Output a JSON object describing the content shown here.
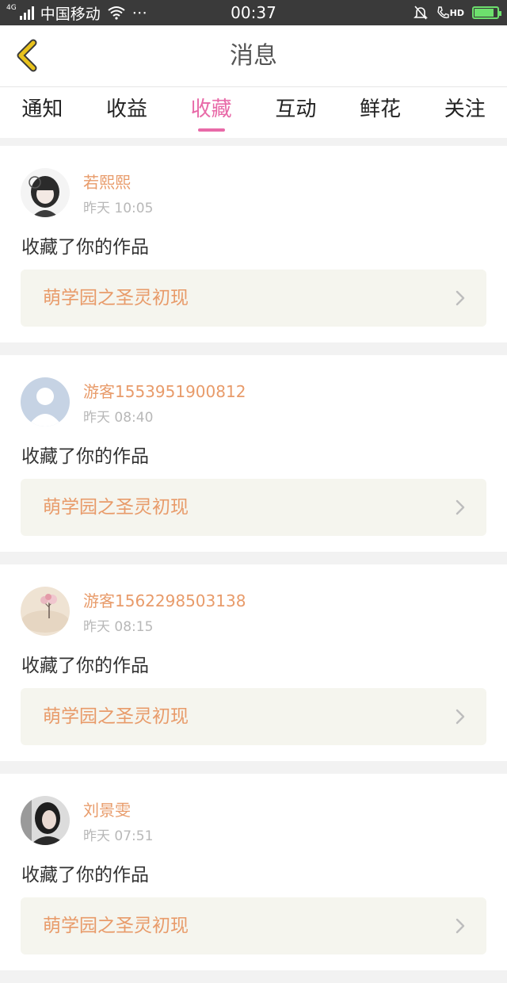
{
  "status": {
    "network": "4G",
    "carrier": "中国移动",
    "time": "00:37",
    "hd": "HD",
    "battery_level": 0.85,
    "accent": "#6de06d"
  },
  "header": {
    "title": "消息",
    "back_icon": "chevron-left-icon",
    "back_color": "#e8c21c"
  },
  "tabs": [
    {
      "label": "通知",
      "active": false
    },
    {
      "label": "收益",
      "active": false
    },
    {
      "label": "收藏",
      "active": true
    },
    {
      "label": "互动",
      "active": false
    },
    {
      "label": "鲜花",
      "active": false
    },
    {
      "label": "关注",
      "active": false
    }
  ],
  "items": [
    {
      "name": "若熙熙",
      "time": "昨天 10:05",
      "action": "收藏了你的作品",
      "work": "萌学园之圣灵初现"
    },
    {
      "name": "游客1553951900812",
      "time": "昨天 08:40",
      "action": "收藏了你的作品",
      "work": "萌学园之圣灵初现"
    },
    {
      "name": "游客1562298503138",
      "time": "昨天 08:15",
      "action": "收藏了你的作品",
      "work": "萌学园之圣灵初现"
    },
    {
      "name": "刘景雯",
      "time": "昨天 07:51",
      "action": "收藏了你的作品",
      "work": "萌学园之圣灵初现"
    }
  ],
  "colors": {
    "active_tab": "#e86aa8",
    "name": "#e89b6a",
    "work_bg": "#f5f5ee"
  }
}
